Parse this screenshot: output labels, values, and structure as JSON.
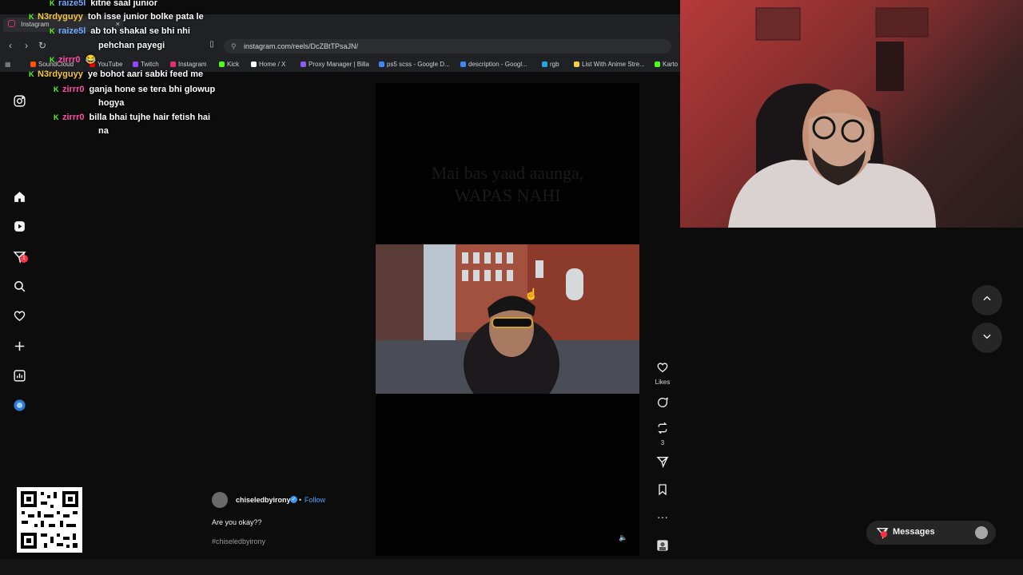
{
  "browser": {
    "tab_title": "Instagram",
    "tab_close": "×",
    "url": "instagram.com/reels/DcZBtTPsaJN/",
    "bookmarks": [
      {
        "label": "SoundCloud",
        "color": "#ff5500"
      },
      {
        "label": "YouTube",
        "color": "#ff0000"
      },
      {
        "label": "Twitch",
        "color": "#9146ff"
      },
      {
        "label": "Instagram",
        "color": "#e1306c"
      },
      {
        "label": "Kick",
        "color": "#53fc18"
      },
      {
        "label": "Home / X",
        "color": "#ffffff"
      },
      {
        "label": "Proxy Manager | Billa",
        "color": "#8b5cf6"
      },
      {
        "label": "ps5 scss - Google D...",
        "color": "#4285f4"
      },
      {
        "label": "description - Googl...",
        "color": "#4285f4"
      },
      {
        "label": "rgb",
        "color": "#26a5e4"
      },
      {
        "label": "List With Anime Stre...",
        "color": "#f4d03f"
      },
      {
        "label": "Karto",
        "color": "#53fc18"
      }
    ]
  },
  "sidebar": {
    "notifications_badge": "1"
  },
  "reel": {
    "overlay_text_line1": "Mai bas yaad aaunga,",
    "overlay_text_line2": "WAPAS NAHI",
    "author": "chiseledbyirony",
    "separator": "•",
    "follow_label": "Follow",
    "caption": "Are you okay??",
    "hashtag": "#chiseledbyirony",
    "likes_label": "Likes",
    "reposts_count": "3"
  },
  "messages": {
    "label": "Messages"
  },
  "chat": [
    {
      "user": "raize5l",
      "color": "#6fa8ff",
      "message": "kitne saal junior"
    },
    {
      "user": "N3rdyguyy",
      "color": "#f5c542",
      "message": "toh isse junior bolke pata le"
    },
    {
      "user": "raize5l",
      "color": "#6fa8ff",
      "message": "ab toh shakal se bhi nhi"
    },
    {
      "user": "",
      "color": "#ffffff",
      "message": "pehchan payegi"
    },
    {
      "user": "zirrr0",
      "color": "#ff4fa3",
      "message": "😂"
    },
    {
      "user": "N3rdyguyy",
      "color": "#f5c542",
      "message": "ye bohot aari sabki feed me"
    },
    {
      "user": "zirrr0",
      "color": "#ff4fa3",
      "message": "ganja hone se tera bhi glowup"
    },
    {
      "user": "",
      "color": "#ffffff",
      "message": "hogya"
    },
    {
      "user": "zirrr0",
      "color": "#ff4fa3",
      "message": "billa bhai tujhe hair fetish hai"
    },
    {
      "user": "",
      "color": "#ffffff",
      "message": "na"
    }
  ]
}
